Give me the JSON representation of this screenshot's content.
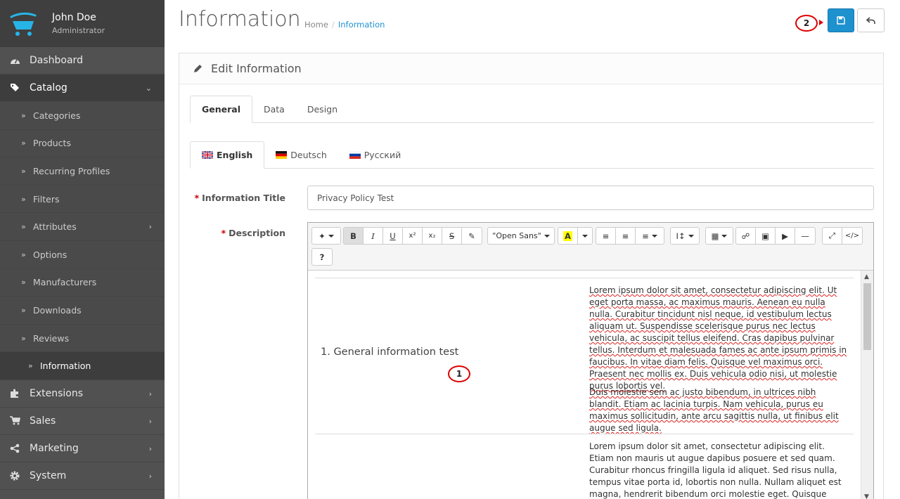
{
  "profile": {
    "name": "John Doe",
    "role": "Administrator"
  },
  "nav": {
    "dashboard": "Dashboard",
    "catalog": "Catalog",
    "sub": [
      "Categories",
      "Products",
      "Recurring Profiles",
      "Filters",
      "Attributes",
      "Options",
      "Manufacturers",
      "Downloads",
      "Reviews",
      "Information"
    ],
    "extensions": "Extensions",
    "sales": "Sales",
    "marketing": "Marketing",
    "system": "System"
  },
  "header": {
    "title": "Information",
    "breadcrumb_home": "Home",
    "breadcrumb_sep": "/",
    "breadcrumb_current": "Information"
  },
  "annotations": {
    "one": "1",
    "two": "2"
  },
  "panel": {
    "title": "Edit Information"
  },
  "tabs": [
    "General",
    "Data",
    "Design"
  ],
  "language_tabs": [
    "English",
    "Deutsch",
    "Русский"
  ],
  "form": {
    "title_label": "Information Title",
    "title_value": "Privacy Policy Test",
    "description_label": "Description",
    "required_mark": "*"
  },
  "toolbar": {
    "bold": "B",
    "italic": "I",
    "underline": "U",
    "superscript": "x²",
    "subscript": "x₂",
    "font_name": "\"Open Sans\"",
    "help": "?"
  },
  "editor": {
    "general_title": "1. General information test",
    "para1": "Lorem ipsum dolor sit amet, consectetur adipiscing elit. Ut eget porta massa, ac maximus mauris. Aenean eu nulla nulla. Curabitur tincidunt nisl neque, id vestibulum lectus aliquam ut. Suspendisse scelerisque purus nec lectus vehicula, ac suscipit tellus eleifend. Cras dapibus pulvinar tellus. Interdum et malesuada fames ac ante ipsum primis in faucibus. In vitae diam felis. Quisque vel maximus orci. Praesent nec mollis ex. Duis vehicula odio nisi, ut molestie purus lobortis vel.",
    "para2": "Duis molestie sem ac justo bibendum, in ultrices nibh blandit. Etiam ac lacinia turpis. Nam vehicula, purus eu maximus sollicitudin, ante arcu sagittis nulla, ut finibus elit augue sed ligula.",
    "para3": "Lorem ipsum dolor sit amet, consectetur adipiscing elit. Etiam non mauris ut augue dapibus posuere et sed quam. Curabitur rhoncus fringilla ligula id aliquet. Sed risus nulla, tempus vitae porta id, lobortis non nulla. Nullam aliquet est magna, hendrerit bibendum orci molestie eget. Quisque sodales, libero convallis eleifend"
  },
  "colors": {
    "accent": "#1e91cf",
    "sidebar": "#515151",
    "annotation": "#dd0000"
  }
}
